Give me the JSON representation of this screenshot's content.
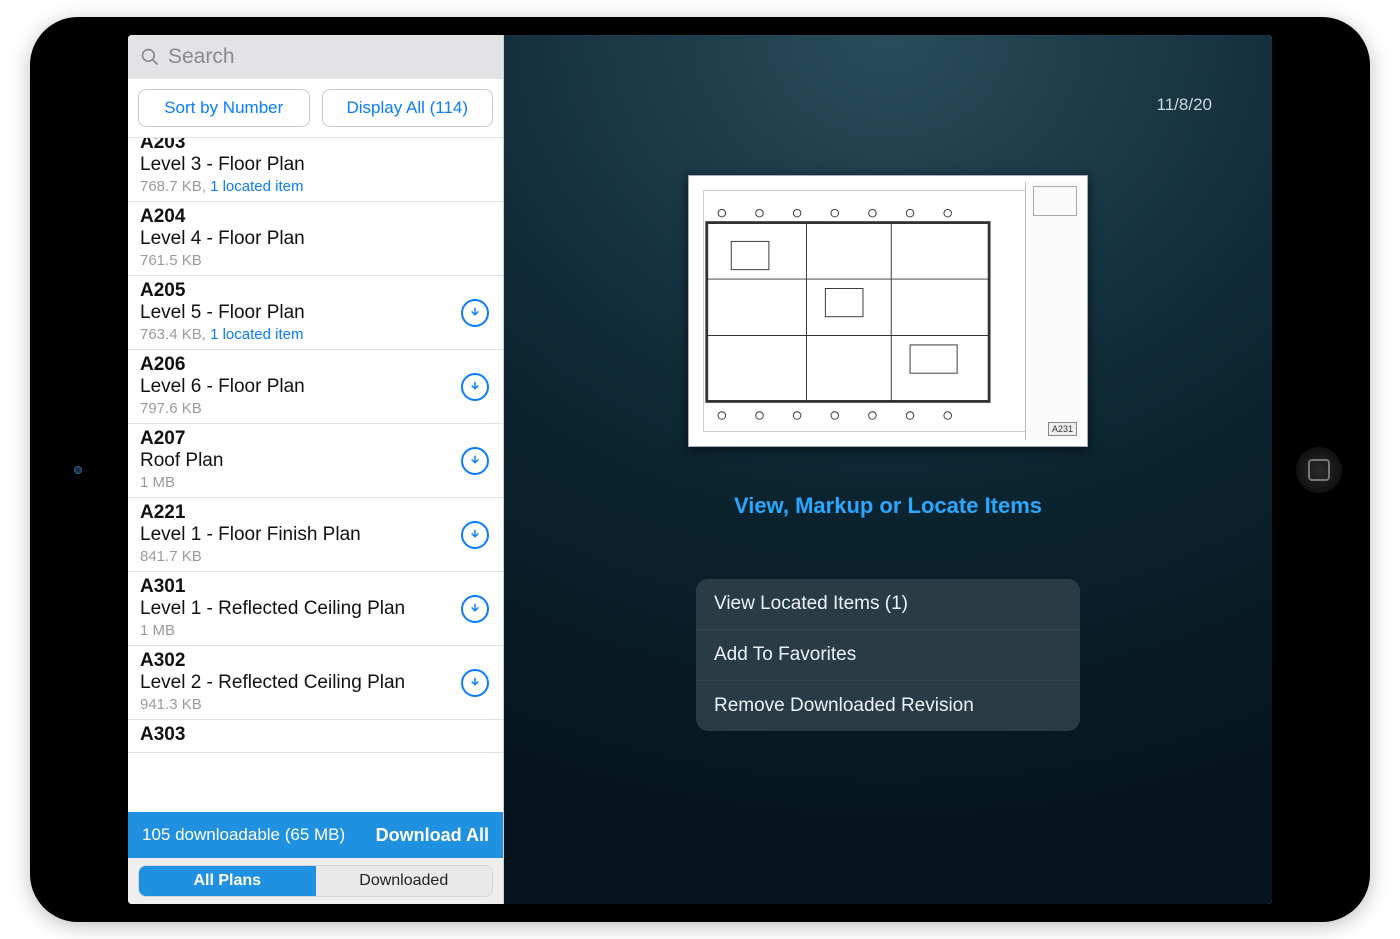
{
  "search": {
    "placeholder": "Search"
  },
  "filters": {
    "sort_label": "Sort by Number",
    "display_label": "Display All (114)"
  },
  "plans": [
    {
      "num": "A203",
      "title": "Level 3 - Floor Plan",
      "size": "768.7 KB",
      "located": "1 located item",
      "downloadable": false
    },
    {
      "num": "A204",
      "title": "Level 4 - Floor Plan",
      "size": "761.5 KB",
      "located": null,
      "downloadable": false
    },
    {
      "num": "A205",
      "title": "Level 5 - Floor Plan",
      "size": "763.4 KB",
      "located": "1 located item",
      "downloadable": true
    },
    {
      "num": "A206",
      "title": "Level 6 - Floor Plan",
      "size": "797.6 KB",
      "located": null,
      "downloadable": true
    },
    {
      "num": "A207",
      "title": "Roof Plan",
      "size": "1 MB",
      "located": null,
      "downloadable": true
    },
    {
      "num": "A221",
      "title": "Level 1 - Floor Finish Plan",
      "size": "841.7 KB",
      "located": null,
      "downloadable": true
    },
    {
      "num": "A301",
      "title": "Level 1 - Reflected Ceiling Plan",
      "size": "1 MB",
      "located": null,
      "downloadable": true
    },
    {
      "num": "A302",
      "title": "Level 2 - Reflected Ceiling Plan",
      "size": "941.3 KB",
      "located": null,
      "downloadable": true
    },
    {
      "num": "A303",
      "title": "",
      "size": "",
      "located": null,
      "downloadable": false
    }
  ],
  "download_bar": {
    "summary": "105 downloadable (65 MB)",
    "action": "Download All"
  },
  "tabs": {
    "all": "All Plans",
    "downloaded": "Downloaded"
  },
  "detail": {
    "date": "11/8/20",
    "sheet_tag": "A231",
    "view_link": "View, Markup or Locate Items",
    "actions": {
      "view_located": "View Located Items (1)",
      "add_fav": "Add To Favorites",
      "remove_rev": "Remove Downloaded Revision"
    }
  }
}
